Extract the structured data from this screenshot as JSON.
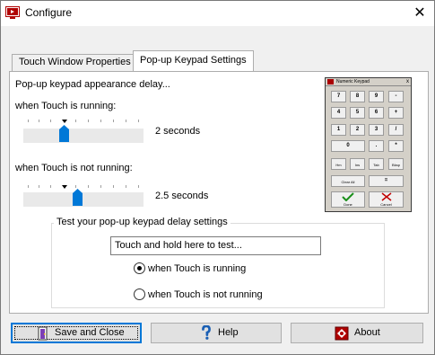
{
  "window": {
    "title": "Configure",
    "close_glyph": "✕"
  },
  "tabs": [
    {
      "label": "Touch Window Properties",
      "active": false
    },
    {
      "label": "Pop-up Keypad Settings",
      "active": true
    }
  ],
  "panel": {
    "heading": "Pop-up keypad appearance delay...",
    "running": {
      "label": "when Touch is running:",
      "value_text": "2 seconds",
      "slider_fraction": 0.33
    },
    "not_running": {
      "label": "when Touch is not running:",
      "value_text": "2.5 seconds",
      "slider_fraction": 0.44
    }
  },
  "keypad_preview": {
    "title": "Numeric Keypad",
    "close": "x",
    "rows": [
      [
        "7",
        "8",
        "9",
        "-"
      ],
      [
        "4",
        "5",
        "6",
        "+"
      ],
      [
        "1",
        "2",
        "3",
        "/"
      ],
      [
        "0",
        ".",
        "*"
      ],
      [
        "Hm",
        "Ins",
        "Tab",
        "Bksp"
      ],
      [
        "Clear All",
        "="
      ],
      [
        "Done",
        "Cancel"
      ]
    ]
  },
  "test_group": {
    "title": "Test your pop-up keypad delay settings",
    "input_value": "Touch and hold here to test...",
    "radio_running": "when Touch is running",
    "radio_not_running": "when Touch is not running",
    "selected": "running"
  },
  "buttons": {
    "save": "Save and Close",
    "help": "Help",
    "about": "About"
  },
  "colors": {
    "accent": "#0078d7",
    "slider_thumb": "#0078d7",
    "brand_red": "#b00000"
  }
}
